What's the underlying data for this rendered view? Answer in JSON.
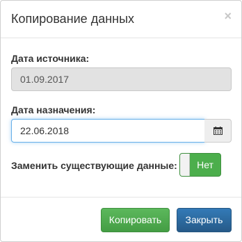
{
  "dialog": {
    "title": "Копирование данных",
    "close_symbol": "×"
  },
  "source_date": {
    "label": "Дата источника:",
    "value": "01.09.2017"
  },
  "target_date": {
    "label": "Дата назначения:",
    "value": "22.06.2018",
    "picker_icon": "calendar-icon"
  },
  "replace_option": {
    "label": "Заменить существующие данные:",
    "state_text": "Нет",
    "enabled": false
  },
  "buttons": {
    "copy_label": "Копировать",
    "close_label": "Закрыть"
  },
  "colors": {
    "success": "#5cb85c",
    "primary": "#337ab7",
    "focus": "#66afe9"
  }
}
